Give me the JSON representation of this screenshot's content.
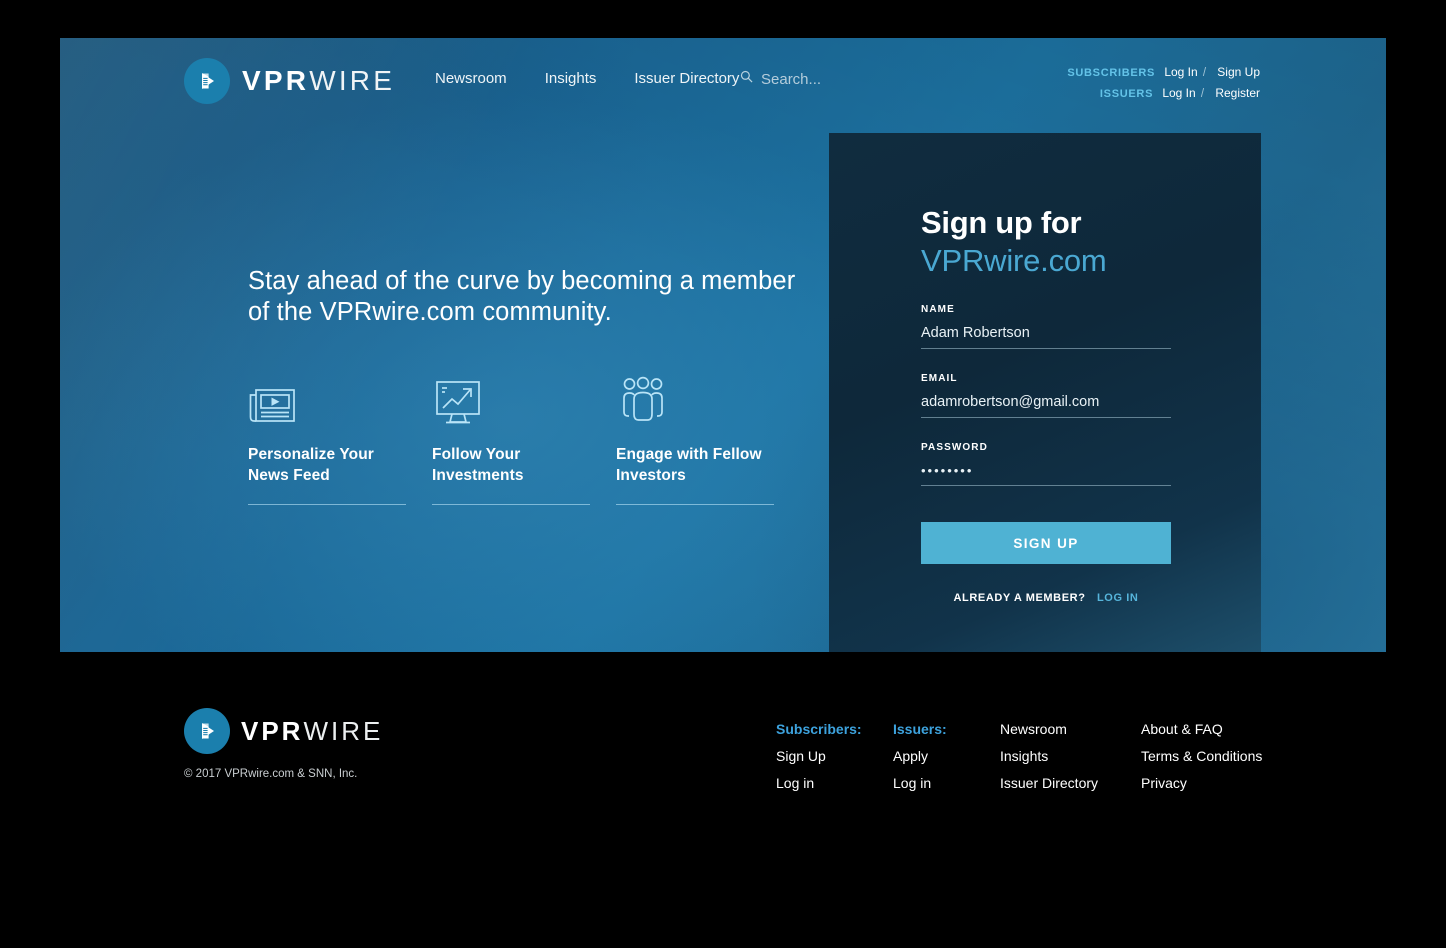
{
  "brand": {
    "name_bold": "VPR",
    "name_light": "WIRE",
    "logo_icon": "play-document-logo-icon",
    "accent_color": "#4aa8d2",
    "button_color": "#4fb2d3",
    "footer_head_color": "#3da2dd"
  },
  "header": {
    "nav": [
      {
        "label": "Newsroom"
      },
      {
        "label": "Insights"
      },
      {
        "label": "Issuer Directory"
      }
    ],
    "search": {
      "icon": "search-icon",
      "placeholder": "Search...",
      "value": ""
    },
    "auth": {
      "subscribers_label": "SUBSCRIBERS",
      "subscribers_login": "Log In",
      "subscribers_signup": "Sign Up",
      "issuers_label": "ISSUERS",
      "issuers_login": "Log In",
      "issuers_register": "Register",
      "separator": "/"
    }
  },
  "hero": {
    "headline": "Stay ahead of the curve by becoming a member of the VPRwire.com community.",
    "features": [
      {
        "icon": "newspaper-play-icon",
        "title": "Personalize Your News Feed"
      },
      {
        "icon": "monitor-trend-up-icon",
        "title": "Follow Your Investments"
      },
      {
        "icon": "people-group-icon",
        "title": "Engage with Fellow Investors"
      }
    ]
  },
  "signup": {
    "title_line1": "Sign up for",
    "title_line2": "VPRwire.com",
    "name_label": "NAME",
    "name_value": "Adam Robertson",
    "name_placeholder": "",
    "email_label": "EMAIL",
    "email_value": "adamrobertson@gmail.com",
    "email_placeholder": "",
    "password_label": "PASSWORD",
    "password_value": "••••••••",
    "password_placeholder": "",
    "submit_label": "SIGN UP",
    "member_question": "ALREADY A MEMBER?",
    "member_login_link": "LOG IN"
  },
  "footer": {
    "copyright": "© 2017 VPRwire.com & SNN, Inc.",
    "columns": [
      {
        "head": "Subscribers:",
        "links": [
          {
            "label": "Sign Up"
          },
          {
            "label": "Log in"
          }
        ]
      },
      {
        "head": "Issuers:",
        "links": [
          {
            "label": "Apply"
          },
          {
            "label": "Log in"
          }
        ]
      },
      {
        "head": "Newsroom",
        "head_plain": true,
        "links": [
          {
            "label": "Insights"
          },
          {
            "label": "Issuer Directory"
          }
        ]
      },
      {
        "head": "About & FAQ",
        "head_plain": true,
        "links": [
          {
            "label": "Terms & Conditions"
          },
          {
            "label": "Privacy"
          }
        ]
      }
    ]
  }
}
